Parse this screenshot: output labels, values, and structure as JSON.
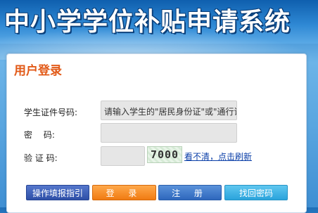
{
  "header": {
    "title": "中小学学位补贴申请系统"
  },
  "login": {
    "title": "用户登录",
    "id_label": "学生证件号码:",
    "id_placeholder": "请输入学生的\"居民身份证\"或\"通行证",
    "password_label": "密　 码:",
    "captcha_label": "验 证 码:",
    "captcha_code": "7000",
    "refresh_text": "看不清，点击刷新"
  },
  "buttons": {
    "guide": "操作填报指引",
    "login": "登 录",
    "register": "注 册",
    "recover": "找回密码"
  }
}
